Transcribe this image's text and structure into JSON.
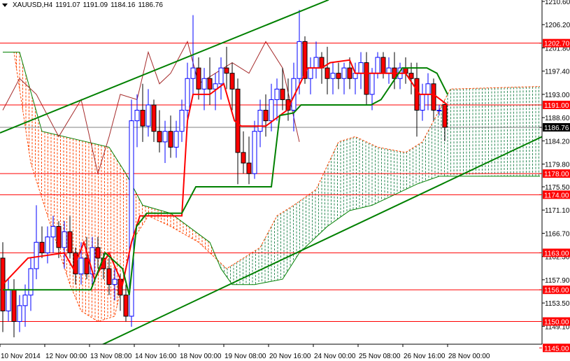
{
  "header": {
    "symbol": "XAUUSD,H4",
    "open": "1191.07",
    "high": "1191.09",
    "low": "1184.16",
    "close": "1186.76"
  },
  "chart_data": {
    "type": "candlestick",
    "title": "XAUUSD,H4",
    "ylim": [
      1144.0,
      1210.9
    ],
    "price_ticks": [
      "1210.60",
      "1206.20",
      "1201.80",
      "1197.40",
      "1193.00",
      "1188.60",
      "1184.20",
      "1179.80",
      "1175.50",
      "1171.10",
      "1166.70",
      "1162.30",
      "1157.90",
      "1153.50",
      "1149.10"
    ],
    "time_labels": [
      "10 Nov 2014",
      "12 Nov 00:00",
      "13 Nov 08:00",
      "14 Nov 16:00",
      "18 Nov 00:00",
      "19 Nov 08:00",
      "20 Nov 16:00",
      "24 Nov 00:00",
      "25 Nov 08:00",
      "26 Nov 16:00",
      "28 Nov 00:00"
    ],
    "levels": [
      {
        "price": 1202.7,
        "label": "1202.70"
      },
      {
        "price": 1191.0,
        "label": "1191.00"
      },
      {
        "price": 1178.0,
        "label": "1178.00"
      },
      {
        "price": 1174.0,
        "label": "1174.00"
      },
      {
        "price": 1163.0,
        "label": "1163.00"
      },
      {
        "price": 1156.0,
        "label": "1156.00"
      },
      {
        "price": 1150.0,
        "label": "1150.00"
      },
      {
        "price": 1145.0,
        "label": "1145.00"
      }
    ],
    "current_price": {
      "price": 1186.76,
      "label": "1186.76"
    },
    "colors": {
      "bull": "#0000ff",
      "bear": "#ff0000",
      "level": "#ff0000",
      "tenkan": "#ff0000",
      "kijun": "#008000",
      "chikou": "#a52a2a",
      "cloud_bear": "#ff4500",
      "cloud_bull": "#2e8b57",
      "trend": "#008000"
    },
    "ohlc": [
      [
        1162,
        1165,
        1148,
        1152
      ],
      [
        1152,
        1158,
        1150,
        1156
      ],
      [
        1156,
        1158,
        1147,
        1150
      ],
      [
        1150,
        1155,
        1148,
        1153
      ],
      [
        1153,
        1157,
        1149,
        1155
      ],
      [
        1155,
        1162,
        1152,
        1160
      ],
      [
        1160,
        1172,
        1158,
        1165
      ],
      [
        1165,
        1168,
        1162,
        1163
      ],
      [
        1163,
        1168,
        1161,
        1166
      ],
      [
        1166,
        1170,
        1163,
        1168
      ],
      [
        1168,
        1169,
        1162,
        1164
      ],
      [
        1164,
        1169,
        1160,
        1167
      ],
      [
        1167,
        1170,
        1162,
        1163
      ],
      [
        1163,
        1164,
        1157,
        1159
      ],
      [
        1159,
        1165,
        1157,
        1162
      ],
      [
        1162,
        1166,
        1158,
        1159
      ],
      [
        1159,
        1166,
        1157,
        1164
      ],
      [
        1164,
        1166,
        1160,
        1162
      ],
      [
        1162,
        1163,
        1158,
        1160
      ],
      [
        1160,
        1162,
        1155,
        1157
      ],
      [
        1157,
        1160,
        1154,
        1158
      ],
      [
        1158,
        1159,
        1152,
        1155
      ],
      [
        1155,
        1157,
        1150,
        1151
      ],
      [
        1151,
        1192,
        1149,
        1188
      ],
      [
        1188,
        1193,
        1183,
        1190
      ],
      [
        1190,
        1195,
        1184,
        1187
      ],
      [
        1187,
        1194,
        1185,
        1191
      ],
      [
        1191,
        1192,
        1184,
        1186
      ],
      [
        1186,
        1190,
        1182,
        1184
      ],
      [
        1184,
        1188,
        1180,
        1186
      ],
      [
        1186,
        1189,
        1181,
        1183
      ],
      [
        1183,
        1188,
        1181,
        1186
      ],
      [
        1186,
        1192,
        1184,
        1190
      ],
      [
        1190,
        1199,
        1188,
        1196
      ],
      [
        1196,
        1208,
        1193,
        1198
      ],
      [
        1198,
        1200,
        1192,
        1194
      ],
      [
        1194,
        1198,
        1190,
        1196
      ],
      [
        1196,
        1200,
        1191,
        1194
      ],
      [
        1194,
        1197,
        1190,
        1195
      ],
      [
        1195,
        1200,
        1192,
        1198
      ],
      [
        1198,
        1202,
        1194,
        1197
      ],
      [
        1197,
        1199,
        1190,
        1194
      ],
      [
        1194,
        1196,
        1176,
        1182
      ],
      [
        1182,
        1186,
        1178,
        1180
      ],
      [
        1180,
        1185,
        1176,
        1178
      ],
      [
        1178,
        1188,
        1177,
        1186
      ],
      [
        1186,
        1192,
        1183,
        1190
      ],
      [
        1190,
        1193,
        1185,
        1188
      ],
      [
        1188,
        1195,
        1186,
        1192
      ],
      [
        1192,
        1196,
        1188,
        1194
      ],
      [
        1194,
        1198,
        1190,
        1192
      ],
      [
        1192,
        1196,
        1188,
        1190
      ],
      [
        1190,
        1199,
        1186,
        1196
      ],
      [
        1196,
        1209,
        1193,
        1203
      ],
      [
        1203,
        1204,
        1195,
        1196
      ],
      [
        1196,
        1200,
        1193,
        1198
      ],
      [
        1198,
        1203,
        1196,
        1200
      ],
      [
        1200,
        1201,
        1195,
        1198
      ],
      [
        1198,
        1202,
        1193,
        1196
      ],
      [
        1196,
        1199,
        1193,
        1197
      ],
      [
        1197,
        1199,
        1194,
        1196
      ],
      [
        1196,
        1199,
        1193,
        1198
      ],
      [
        1198,
        1200,
        1194,
        1196
      ],
      [
        1196,
        1199,
        1193,
        1197
      ],
      [
        1197,
        1201,
        1194,
        1199
      ],
      [
        1199,
        1201,
        1191,
        1193
      ],
      [
        1193,
        1198,
        1190,
        1197
      ],
      [
        1197,
        1201,
        1196,
        1200
      ],
      [
        1200,
        1201,
        1196,
        1197
      ],
      [
        1197,
        1200,
        1195,
        1198
      ],
      [
        1198,
        1201,
        1194,
        1196
      ],
      [
        1196,
        1199,
        1194,
        1198
      ],
      [
        1198,
        1200,
        1195,
        1197
      ],
      [
        1197,
        1199,
        1193,
        1196
      ],
      [
        1196,
        1199,
        1185,
        1190
      ],
      [
        1190,
        1195,
        1188,
        1193
      ],
      [
        1193,
        1197,
        1190,
        1195
      ],
      [
        1195,
        1196,
        1188,
        1190
      ],
      [
        1190,
        1191,
        1189,
        1190
      ],
      [
        1191.07,
        1191.09,
        1184.16,
        1186.76
      ]
    ],
    "tenkan": [
      [
        0,
        1157
      ],
      [
        4.5,
        1162
      ],
      [
        11,
        1163
      ],
      [
        12.6,
        1160
      ],
      [
        14.5,
        1165
      ],
      [
        16.4,
        1158
      ],
      [
        19,
        1163
      ],
      [
        21.4,
        1157
      ],
      [
        23,
        1165
      ],
      [
        24.5,
        1170
      ],
      [
        32,
        1170
      ],
      [
        33,
        1188
      ],
      [
        34,
        1193
      ],
      [
        37,
        1193
      ],
      [
        39.5,
        1195
      ],
      [
        41.4,
        1188
      ],
      [
        42.6,
        1187
      ],
      [
        47,
        1187
      ],
      [
        50.8,
        1190
      ],
      [
        54.5,
        1198
      ],
      [
        57,
        1198
      ],
      [
        58.5,
        1199
      ],
      [
        62,
        1199.5
      ],
      [
        63,
        1197
      ],
      [
        67,
        1197
      ],
      [
        72,
        1197
      ],
      [
        74.5,
        1193
      ],
      [
        77,
        1193
      ],
      [
        79.5,
        1191
      ]
    ],
    "kijun": [
      [
        0,
        1156
      ],
      [
        15.75,
        1156
      ],
      [
        18.3,
        1163
      ],
      [
        21.4,
        1160
      ],
      [
        22.6,
        1155
      ],
      [
        23.9,
        1168
      ],
      [
        25.75,
        1170.5
      ],
      [
        32,
        1170.5
      ],
      [
        34.5,
        1175.5
      ],
      [
        48,
        1175.5
      ],
      [
        49.5,
        1189
      ],
      [
        52,
        1189.5
      ],
      [
        53.3,
        1191
      ],
      [
        65.8,
        1191
      ],
      [
        67.6,
        1192
      ],
      [
        69.5,
        1195
      ],
      [
        71.4,
        1198
      ],
      [
        75.8,
        1198
      ],
      [
        77.6,
        1197
      ],
      [
        79.5,
        1193
      ]
    ],
    "span_a": [
      [
        0,
        1201
      ],
      [
        2,
        1201
      ],
      [
        5,
        1180
      ],
      [
        8,
        1170
      ],
      [
        12,
        1157
      ],
      [
        14,
        1152
      ],
      [
        17,
        1150
      ],
      [
        20,
        1151
      ],
      [
        23,
        1165
      ],
      [
        26,
        1170
      ],
      [
        30,
        1168
      ],
      [
        35,
        1165
      ],
      [
        38,
        1162
      ],
      [
        40,
        1160
      ],
      [
        43,
        1162
      ],
      [
        46,
        1164
      ],
      [
        49,
        1170
      ],
      [
        52,
        1172
      ],
      [
        56,
        1175
      ],
      [
        60,
        1184
      ],
      [
        63,
        1185
      ],
      [
        67,
        1183
      ],
      [
        72,
        1182
      ],
      [
        75,
        1184
      ],
      [
        78,
        1190
      ],
      [
        80,
        1194
      ],
      [
        96,
        1194.5
      ]
    ],
    "span_b": [
      [
        0,
        1201
      ],
      [
        3,
        1201
      ],
      [
        7,
        1186
      ],
      [
        15,
        1184
      ],
      [
        19,
        1183
      ],
      [
        22,
        1178
      ],
      [
        25,
        1172
      ],
      [
        30,
        1170.5
      ],
      [
        37,
        1165
      ],
      [
        39,
        1160
      ],
      [
        41,
        1157
      ],
      [
        45,
        1157
      ],
      [
        50,
        1158
      ],
      [
        53,
        1163
      ],
      [
        58,
        1168
      ],
      [
        62,
        1171
      ],
      [
        66,
        1172
      ],
      [
        70,
        1174
      ],
      [
        74,
        1176
      ],
      [
        78,
        1177.5
      ],
      [
        96,
        1177.5
      ]
    ],
    "chikou": [
      [
        0,
        1190
      ],
      [
        3,
        1196
      ],
      [
        6,
        1193
      ],
      [
        10,
        1185
      ],
      [
        14,
        1192
      ],
      [
        17,
        1178
      ],
      [
        19,
        1185
      ],
      [
        21,
        1193
      ],
      [
        24,
        1192
      ],
      [
        26,
        1201
      ],
      [
        28,
        1195
      ],
      [
        30,
        1197
      ],
      [
        33,
        1203
      ],
      [
        35,
        1195
      ],
      [
        38,
        1197
      ],
      [
        41,
        1199
      ],
      [
        44,
        1197
      ],
      [
        47,
        1203
      ],
      [
        50,
        1198
      ],
      [
        53,
        1184
      ]
    ],
    "trendlines": [
      {
        "name": "upper-channel",
        "from": [
          -0.5,
          1185.7
        ],
        "to": [
          58.25,
          1210.9
        ]
      },
      {
        "name": "lower-channel",
        "from": [
          15.75,
          1144.6
        ],
        "to": [
          96.4,
          1185.0
        ]
      }
    ]
  }
}
